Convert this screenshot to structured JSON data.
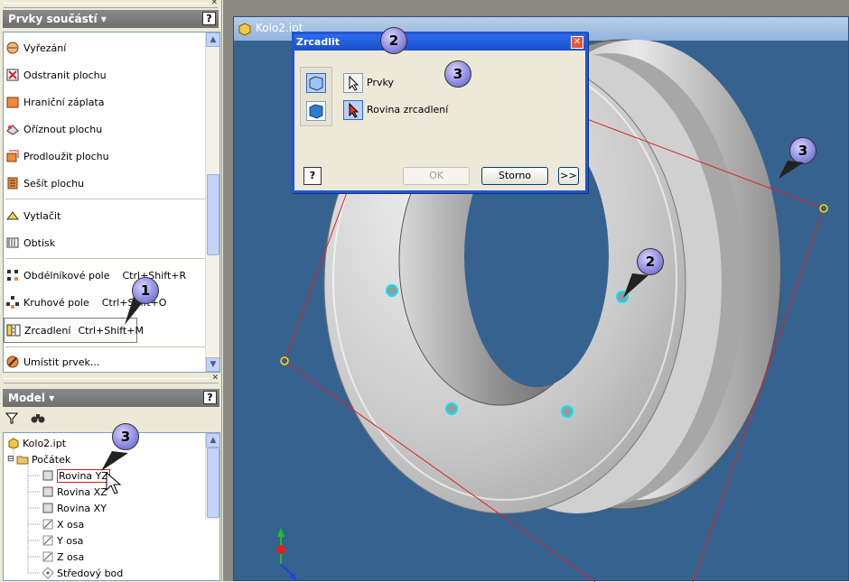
{
  "features_panel": {
    "title": "Prvky součástí ▾",
    "help": "?",
    "items": [
      {
        "label": "Vyřezání",
        "icon": "cut-icon"
      },
      {
        "label": "Odstranit plochu",
        "icon": "delete-face-icon"
      },
      {
        "label": "Hraniční záplata",
        "icon": "boundary-patch-icon"
      },
      {
        "label": "Oříznout plochu",
        "icon": "trim-surface-icon"
      },
      {
        "label": "Prodloužit plochu",
        "icon": "extend-surface-icon"
      },
      {
        "label": "Sešít plochu",
        "icon": "stitch-surface-icon"
      },
      {
        "label": "Vytlačit",
        "icon": "emboss-icon"
      },
      {
        "label": "Obtisk",
        "icon": "decal-icon"
      },
      {
        "label": "Obdélníkové pole",
        "shortcut": "Ctrl+Shift+R",
        "icon": "rect-pattern-icon"
      },
      {
        "label": "Kruhové pole",
        "shortcut": "Ctrl+Shift+O",
        "icon": "circ-pattern-icon"
      },
      {
        "label": "Zrcadlení",
        "shortcut": "Ctrl+Shift+M",
        "icon": "mirror-icon"
      },
      {
        "label": "Umístit prvek...",
        "icon": "place-feature-icon"
      }
    ]
  },
  "model_panel": {
    "title": "Model ▾",
    "help": "?",
    "tree": [
      {
        "label": "Kolo2.ipt",
        "icon": "part-icon",
        "level": 0
      },
      {
        "label": "Počátek",
        "icon": "folder-icon",
        "level": 1
      },
      {
        "label": "Rovina YZ",
        "icon": "plane-icon",
        "level": 2,
        "selected": true
      },
      {
        "label": "Rovina XZ",
        "icon": "plane-icon",
        "level": 2
      },
      {
        "label": "Rovina XY",
        "icon": "plane-icon",
        "level": 2
      },
      {
        "label": "X osa",
        "icon": "axis-icon",
        "level": 2
      },
      {
        "label": "Y osa",
        "icon": "axis-icon",
        "level": 2
      },
      {
        "label": "Z osa",
        "icon": "axis-icon",
        "level": 2
      },
      {
        "label": "Středový bod",
        "icon": "center-point-icon",
        "level": 2
      }
    ]
  },
  "document": {
    "title": "Kolo2.ipt"
  },
  "dialog": {
    "title": "Zrcadlit",
    "close": "✕",
    "features_label": "Prvky",
    "plane_label": "Rovina zrcadlení",
    "ok": "OK",
    "cancel": "Storno",
    "more": ">>",
    "help": "?"
  },
  "callouts": [
    "1",
    "2",
    "2",
    "3",
    "3",
    "3"
  ],
  "colors": {
    "viewport_bg": "#36628f",
    "title_blue": "#2055d4",
    "callout": "#8f8ce0",
    "plane_line": "#e02020"
  }
}
